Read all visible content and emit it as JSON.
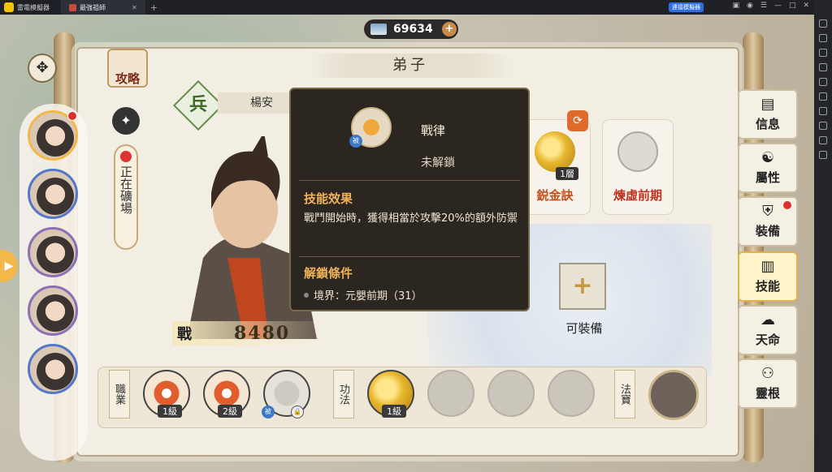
{
  "emulator": {
    "app_name": "雷電模擬器",
    "tab_label": "最強祖師",
    "badge": "連接模擬器"
  },
  "currency": {
    "amount": "69634"
  },
  "header": {
    "title": "弟子",
    "strategy_label": "攻略"
  },
  "disciple": {
    "class_char": "兵",
    "name": "楊安",
    "status_text": "正在礦場",
    "power_label": "戰",
    "power": "8480"
  },
  "tooltip": {
    "skill_name": "戰律",
    "state": "未解鎖",
    "tag": "被",
    "effect_title": "技能效果",
    "effect_text": "戰鬥開始時，獲得相當於攻擊20%的額外防禦",
    "unlock_title": "解鎖條件",
    "unlock_text": "境界：元嬰前期（31）"
  },
  "skill_cards": [
    {
      "name": "鋭金訣",
      "level": "1層",
      "color": "#c0501f"
    },
    {
      "name": "煉虛前期",
      "color": "#c0301f"
    }
  ],
  "equip": {
    "label": "可裝備"
  },
  "bottom": {
    "tag_career": "職業",
    "tag_method": "功法",
    "tag_treasure": "法寶",
    "slot1_level": "1級",
    "slot2_level": "2級",
    "slot3_tag": "被",
    "slot4_level": "1級"
  },
  "right_menu": [
    {
      "label": "信息",
      "icon": "scroll-icon"
    },
    {
      "label": "屬性",
      "icon": "figure-icon"
    },
    {
      "label": "裝備",
      "icon": "armor-icon"
    },
    {
      "label": "技能",
      "icon": "book-icon"
    },
    {
      "label": "天命",
      "icon": "cloud-icon"
    },
    {
      "label": "靈根",
      "icon": "node-icon"
    }
  ]
}
